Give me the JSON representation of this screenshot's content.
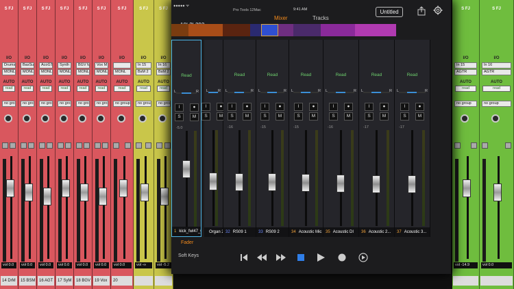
{
  "background_mixer": {
    "strip_label": "S FJ",
    "io_label": "I/O",
    "auto_label": "AUTO",
    "read_label": "read",
    "group_label": "no group",
    "strips": [
      {
        "name": "14 DrM",
        "input": "Drums M",
        "output": "MONL",
        "vol": "vol 0.0",
        "color": "#d9575e"
      },
      {
        "name": "15 BSM",
        "input": "BasSub",
        "output": "MONL",
        "vol": "vol 0.0",
        "color": "#d9575e"
      },
      {
        "name": "16 AGT",
        "input": "AcoGTRM",
        "output": "MONL",
        "vol": "vol 0.0",
        "color": "#d9575e"
      },
      {
        "name": "17 SyM",
        "input": "Synth M",
        "output": "MONL",
        "vol": "vol 0.0",
        "color": "#d9575e"
      },
      {
        "name": "18 BGV",
        "input": "BGV M",
        "output": "MONL",
        "vol": "vol 0.0",
        "color": "#d9575e"
      },
      {
        "name": "19 Vox",
        "input": "Vox M",
        "output": "MONL",
        "vol": "vol 0.0",
        "color": "#d9575e"
      },
      {
        "name": "20",
        "input": "",
        "output": "MONL",
        "vol": "vol 0.0",
        "color": "#d9575e"
      },
      {
        "name": "",
        "input": "In 15",
        "output": "BsM 2",
        "vol": "vol -∞",
        "color": "#c9c64a"
      },
      {
        "name": "",
        "input": "In 16",
        "output": "BsM 2",
        "vol": "vol -5.2",
        "color": "#c9c64a"
      },
      {
        "name": "",
        "input": "In 15",
        "output": "AGTR",
        "vol": "vol -14.9",
        "color": "#6fbd3e"
      },
      {
        "name": "",
        "input": "In 16",
        "output": "AGTR",
        "vol": "vol 0.0",
        "color": "#6fbd3e"
      }
    ]
  },
  "ipad": {
    "status": {
      "carrier": "●●●●● ᯤ",
      "app": "Pro Tools 12Mac",
      "time": "9:41 AM",
      "battery": "100%"
    },
    "counter": "10| 2| 292",
    "tabs": {
      "mixer": "Mixer",
      "tracks": "Tracks"
    },
    "session_name": "Untitled",
    "overview_colors": [
      "#7a3c10",
      "#a84d18",
      "#5a2410",
      "#2a2a70",
      "#2f4fd0",
      "#6f2e80",
      "#4a2a6a",
      "#8a2a9a",
      "#b03ab0"
    ],
    "strips": [
      {
        "num": "1",
        "name": "kick_fwl47_01",
        "automation": "Read",
        "value": "-5.0",
        "fader": 0.62,
        "numColor": "#e8b33c",
        "selected": true
      },
      {
        "num": "",
        "name": "Organ 2",
        "automation": "",
        "value": "",
        "fader": 0.46,
        "numColor": "#e8b33c",
        "selected": false
      },
      {
        "num": "32",
        "name": "RS09 1",
        "automation": "Read",
        "value": "-16",
        "fader": 0.45,
        "numColor": "#6f8cff",
        "selected": false
      },
      {
        "num": "33",
        "name": "RS09 2",
        "automation": "Read",
        "value": "-15",
        "fader": 0.45,
        "numColor": "#6f8cff",
        "selected": false
      },
      {
        "num": "34",
        "name": "Acoustic Mic",
        "automation": "Read",
        "value": "-15",
        "fader": 0.44,
        "numColor": "#f2a33c",
        "selected": false
      },
      {
        "num": "35",
        "name": "Acoustic DI",
        "automation": "Read",
        "value": "-16",
        "fader": 0.43,
        "numColor": "#f2a33c",
        "selected": false
      },
      {
        "num": "36",
        "name": "Acoustic 2...",
        "automation": "Read",
        "value": "-17",
        "fader": 0.42,
        "numColor": "#f2a33c",
        "selected": false
      },
      {
        "num": "37",
        "name": "Acoustic 3...",
        "automation": "Read",
        "value": "-17",
        "fader": 0.42,
        "numColor": "#f2a33c",
        "selected": false
      }
    ],
    "button_labels": {
      "input": "I",
      "solo": "S",
      "mute": "M"
    },
    "pan_labels": {
      "left": "L",
      "right": "R"
    },
    "bottom": {
      "fader_label": "Fader",
      "soft_keys_label": "Soft Keys"
    }
  }
}
